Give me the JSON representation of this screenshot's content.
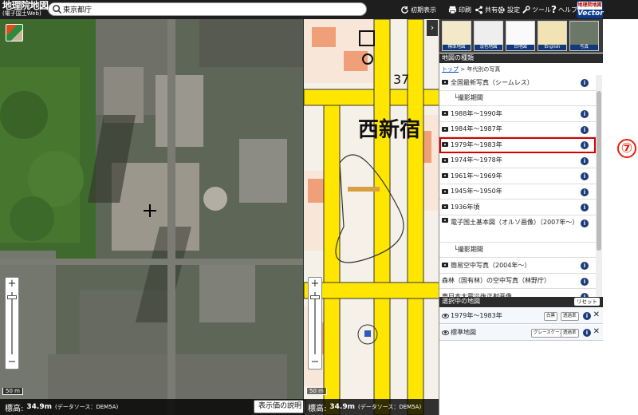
{
  "header": {
    "logo_main": "地理院地図",
    "logo_sub": "(電子国土Web)",
    "search_value": "東京都庁",
    "buttons": {
      "initial": "初期表示",
      "print": "印刷",
      "share": "共有",
      "settings": "設定",
      "tools": "ツール",
      "help": "ヘルプ"
    },
    "vector_logo_top": "地理院地図",
    "vector_logo_bottom": "Vector"
  },
  "map": {
    "plan_label": "西新宿",
    "plan_number": "37",
    "scale_left": "50 m",
    "scale_right": "50 m",
    "elevation_label": "標高:",
    "elevation_value_left": "34.9m",
    "elevation_value_right": "34.9m",
    "data_source": "(データソース：DEM5A)",
    "legend_button": "表示価の説明"
  },
  "panel": {
    "tiles": [
      "標準地図",
      "淡色地図",
      "白地図",
      "English",
      "写真"
    ],
    "map_types_header": "地図の種類",
    "breadcrumb_top": "トップ",
    "breadcrumb_sep": "> 年代別の写真",
    "list_items": [
      {
        "label": "全国最新写真（シームレス）",
        "type": "photo"
      },
      {
        "label": "└撮影期間",
        "type": "sub"
      },
      {
        "label": "1988年〜1990年",
        "type": "photo"
      },
      {
        "label": "1984年〜1987年",
        "type": "photo"
      },
      {
        "label": "1979年〜1983年",
        "type": "photo"
      },
      {
        "label": "1974年〜1978年",
        "type": "photo"
      },
      {
        "label": "1961年〜1969年",
        "type": "photo"
      },
      {
        "label": "1945年〜1950年",
        "type": "photo"
      },
      {
        "label": "1936年頃",
        "type": "photo"
      },
      {
        "label": "電子国土基本図（オルソ画像）（2007年〜）",
        "type": "tall"
      },
      {
        "label": "└撮影期間",
        "type": "sub"
      },
      {
        "label": "簡易空中写真（2004年〜）",
        "type": "photo"
      },
      {
        "label": "森林（国有林）の空中写真（林野庁）",
        "type": "plain"
      },
      {
        "label": "東日本大震災後正射画像",
        "type": "plain"
      }
    ],
    "selected_header": "選択中の地図",
    "reset_button": "リセット",
    "selected": [
      {
        "label": "1979年〜1983年",
        "chips": [
          "白黒",
          "透過率"
        ]
      },
      {
        "label": "標準地図",
        "chips": [
          "グレースケール",
          "透過率"
        ]
      }
    ]
  },
  "annotation": "⑦"
}
